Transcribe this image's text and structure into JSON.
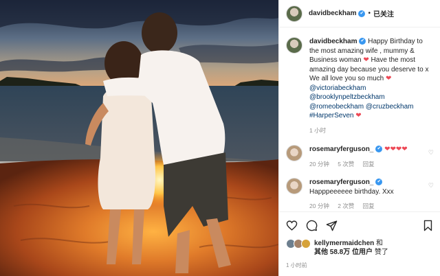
{
  "post": {
    "username": "davidbeckham",
    "follow_state": "已关注",
    "verified_glyph": "✔"
  },
  "caption": {
    "username": "davidbeckham",
    "text_1": "Happy Birthday to the most amazing wife , mummy & Business woman",
    "text_2": "Have the most amazing day because you deserve to x We all love you so much",
    "mentions": [
      "@victoriabeckham",
      "@brooklynpeltzbeckham",
      "@romeobeckham",
      "@cruzbeckham"
    ],
    "hashtag": "#HarperSeven",
    "time": "1 小时"
  },
  "comments": [
    {
      "username": "rosemaryferguson_",
      "text": "❤❤❤❤",
      "time": "20 分钟",
      "likes": "5 次赞",
      "reply": "回复"
    },
    {
      "username": "rosemaryferguson_",
      "text": "Happpeeeeee birthday. Xxx",
      "time": "20 分钟",
      "likes": "2 次赞",
      "reply": "回复"
    }
  ],
  "likes": {
    "liker": "kellymermaidchen",
    "conj": "和",
    "others_prefix": "其他",
    "others_count": "58.8万",
    "others_suffix": "位用户",
    "liked": "赞了"
  },
  "timestamp": "1 小时前",
  "icons": [
    "heart-icon",
    "comment-icon",
    "share-icon",
    "bookmark-icon"
  ],
  "colors": {
    "mention": "#00376b",
    "heart": "#ed4956",
    "verified": "#3897f0",
    "muted": "#8e8e8e"
  }
}
